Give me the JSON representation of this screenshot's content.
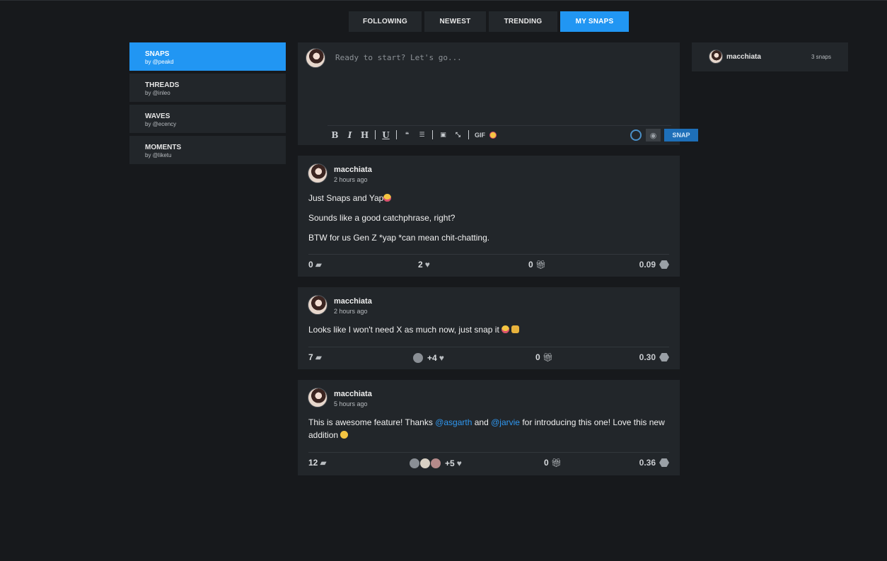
{
  "tabs": [
    {
      "label": "FOLLOWING"
    },
    {
      "label": "NEWEST"
    },
    {
      "label": "TRENDING"
    },
    {
      "label": "MY SNAPS"
    }
  ],
  "nav": [
    {
      "title": "SNAPS",
      "by": "by @peakd"
    },
    {
      "title": "THREADS",
      "by": "by @inleo"
    },
    {
      "title": "WAVES",
      "by": "by @ecency"
    },
    {
      "title": "MOMENTS",
      "by": "by @liketu"
    }
  ],
  "composer": {
    "placeholder": "Ready to start? Let's go...",
    "gif_label": "GIF",
    "snap_label": "SNAP",
    "icons": [
      "bold-icon",
      "italic-icon",
      "heading-icon",
      "underline-icon",
      "quote-icon",
      "list-icon",
      "image-icon",
      "collapse-icon",
      "gif-icon",
      "emoji-icon"
    ]
  },
  "posts": [
    {
      "author": "macchiata",
      "time": "2 hours ago",
      "lines": [
        "Just Snaps and Yap",
        "Sounds like a good catchphrase, right?",
        "BTW for us Gen Z *yap *can mean chit-chatting."
      ],
      "comments": "0",
      "votes": "2",
      "tips": "0",
      "payout": "0.09"
    },
    {
      "author": "macchiata",
      "time": "2 hours ago",
      "lines": [
        "Looks like I won't need X as much now, just snap it"
      ],
      "comments": "7",
      "votes": "+4",
      "tips": "0",
      "payout": "0.30"
    },
    {
      "author": "macchiata",
      "time": "5 hours ago",
      "text_parts": {
        "a": "This is awesome feature! Thanks ",
        "mention1": "@asgarth",
        "b": " and ",
        "mention2": "@jarvie",
        "c": " for introducing this one! Love this new addition "
      },
      "comments": "12",
      "votes": "+5",
      "tips": "0",
      "payout": "0.36"
    }
  ],
  "sidebar_right": {
    "name": "macchiata",
    "count": "3 snaps"
  },
  "colors": {
    "accent": "#2196f3",
    "link": "#2f97f0",
    "background": "#17191c",
    "card": "#22262a"
  }
}
